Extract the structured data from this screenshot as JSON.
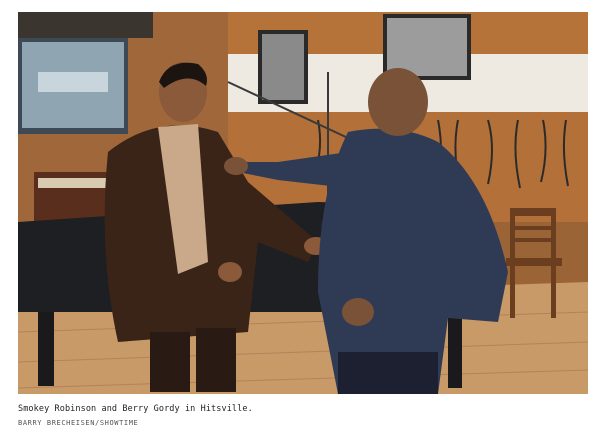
{
  "figure": {
    "caption": "Smokey Robinson and Berry Gordy in Hitsville.",
    "credit": "BARRY BRECHEISEN/SHOWTIME"
  },
  "colors": {
    "wall_wood": "#b5733a",
    "wall_white": "#eeeae2",
    "floor": "#c89a68",
    "piano": "#1e1f22",
    "sweater_navy": "#2f3b55",
    "jacket_brown": "#3a2418",
    "turtleneck_tan": "#c9a98a"
  }
}
